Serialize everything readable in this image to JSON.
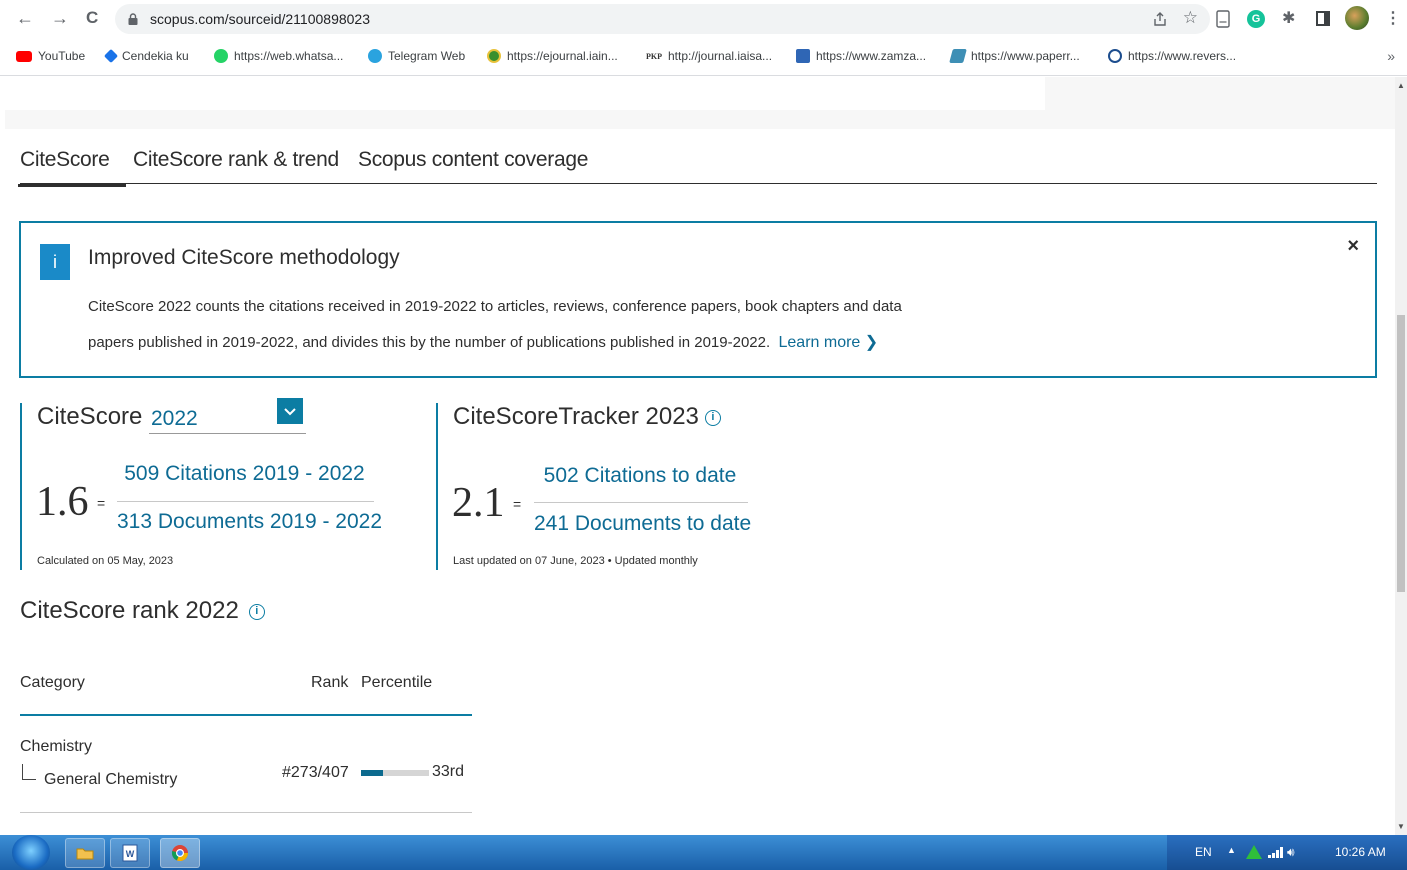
{
  "browser": {
    "url": "scopus.com/sourceid/21100898023",
    "nav": {
      "back": "←",
      "forward": "→",
      "reload": "C"
    }
  },
  "bookmarks": [
    {
      "label": "YouTube",
      "icon": "youtube-icon",
      "color": "#ff0000"
    },
    {
      "label": "Cendekia ku",
      "icon": "cendekia-icon",
      "color": "#1a73e8"
    },
    {
      "label": "https://web.whatsa...",
      "icon": "whatsapp-icon",
      "color": "#25d366"
    },
    {
      "label": "Telegram Web",
      "icon": "telegram-icon",
      "color": "#2aa3df"
    },
    {
      "label": "https://ejournal.iain...",
      "icon": "ejournal-icon",
      "color": "#3a8f2d"
    },
    {
      "label": "http://journal.iaisa...",
      "icon": "pkp-icon",
      "color": "#333333",
      "prefix": "PKP"
    },
    {
      "label": "https://www.zamza...",
      "icon": "zamzar-icon",
      "color": "#2f66b5"
    },
    {
      "label": "https://www.paperr...",
      "icon": "paperrater-icon",
      "color": "#3e8fb5"
    },
    {
      "label": "https://www.revers...",
      "icon": "reverso-icon",
      "color": "#1c4d8e"
    }
  ],
  "tabs": [
    {
      "label": "CiteScore",
      "active": true
    },
    {
      "label": "CiteScore rank & trend",
      "active": false
    },
    {
      "label": "Scopus content coverage",
      "active": false
    }
  ],
  "notice": {
    "badge": "i",
    "title": "Improved CiteScore methodology",
    "line1": "CiteScore 2022 counts the citations received in 2019-2022 to articles, reviews, conference papers, book chapters and data",
    "line2": "papers published in 2019-2022, and divides this by the number of publications published in 2019-2022.",
    "learn_more": "Learn more",
    "close": "×"
  },
  "citescore": {
    "label": "CiteScore",
    "year": "2022",
    "value": "1.6",
    "equals": "=",
    "citations": "509 Citations 2019 - 2022",
    "documents": "313 Documents 2019 - 2022",
    "calculated": "Calculated on 05 May, 2023"
  },
  "tracker": {
    "label": "CiteScoreTracker 2023",
    "value": "2.1",
    "equals": "=",
    "citations": "502 Citations to date",
    "documents": "241 Documents to date",
    "updated": "Last updated on 07 June, 2023 • Updated monthly"
  },
  "rank": {
    "title": "CiteScore rank 2022",
    "headers": {
      "category": "Category",
      "rank": "Rank",
      "percentile": "Percentile"
    },
    "rows": [
      {
        "category": "Chemistry",
        "subcategory": "General Chemistry",
        "rank": "#273/407",
        "percentile": "33rd",
        "percentile_value": 33
      }
    ]
  },
  "taskbar": {
    "lang": "EN",
    "time": "10:26 AM"
  },
  "colors": {
    "accent": "#0c7da3",
    "link": "#0e6b94"
  }
}
